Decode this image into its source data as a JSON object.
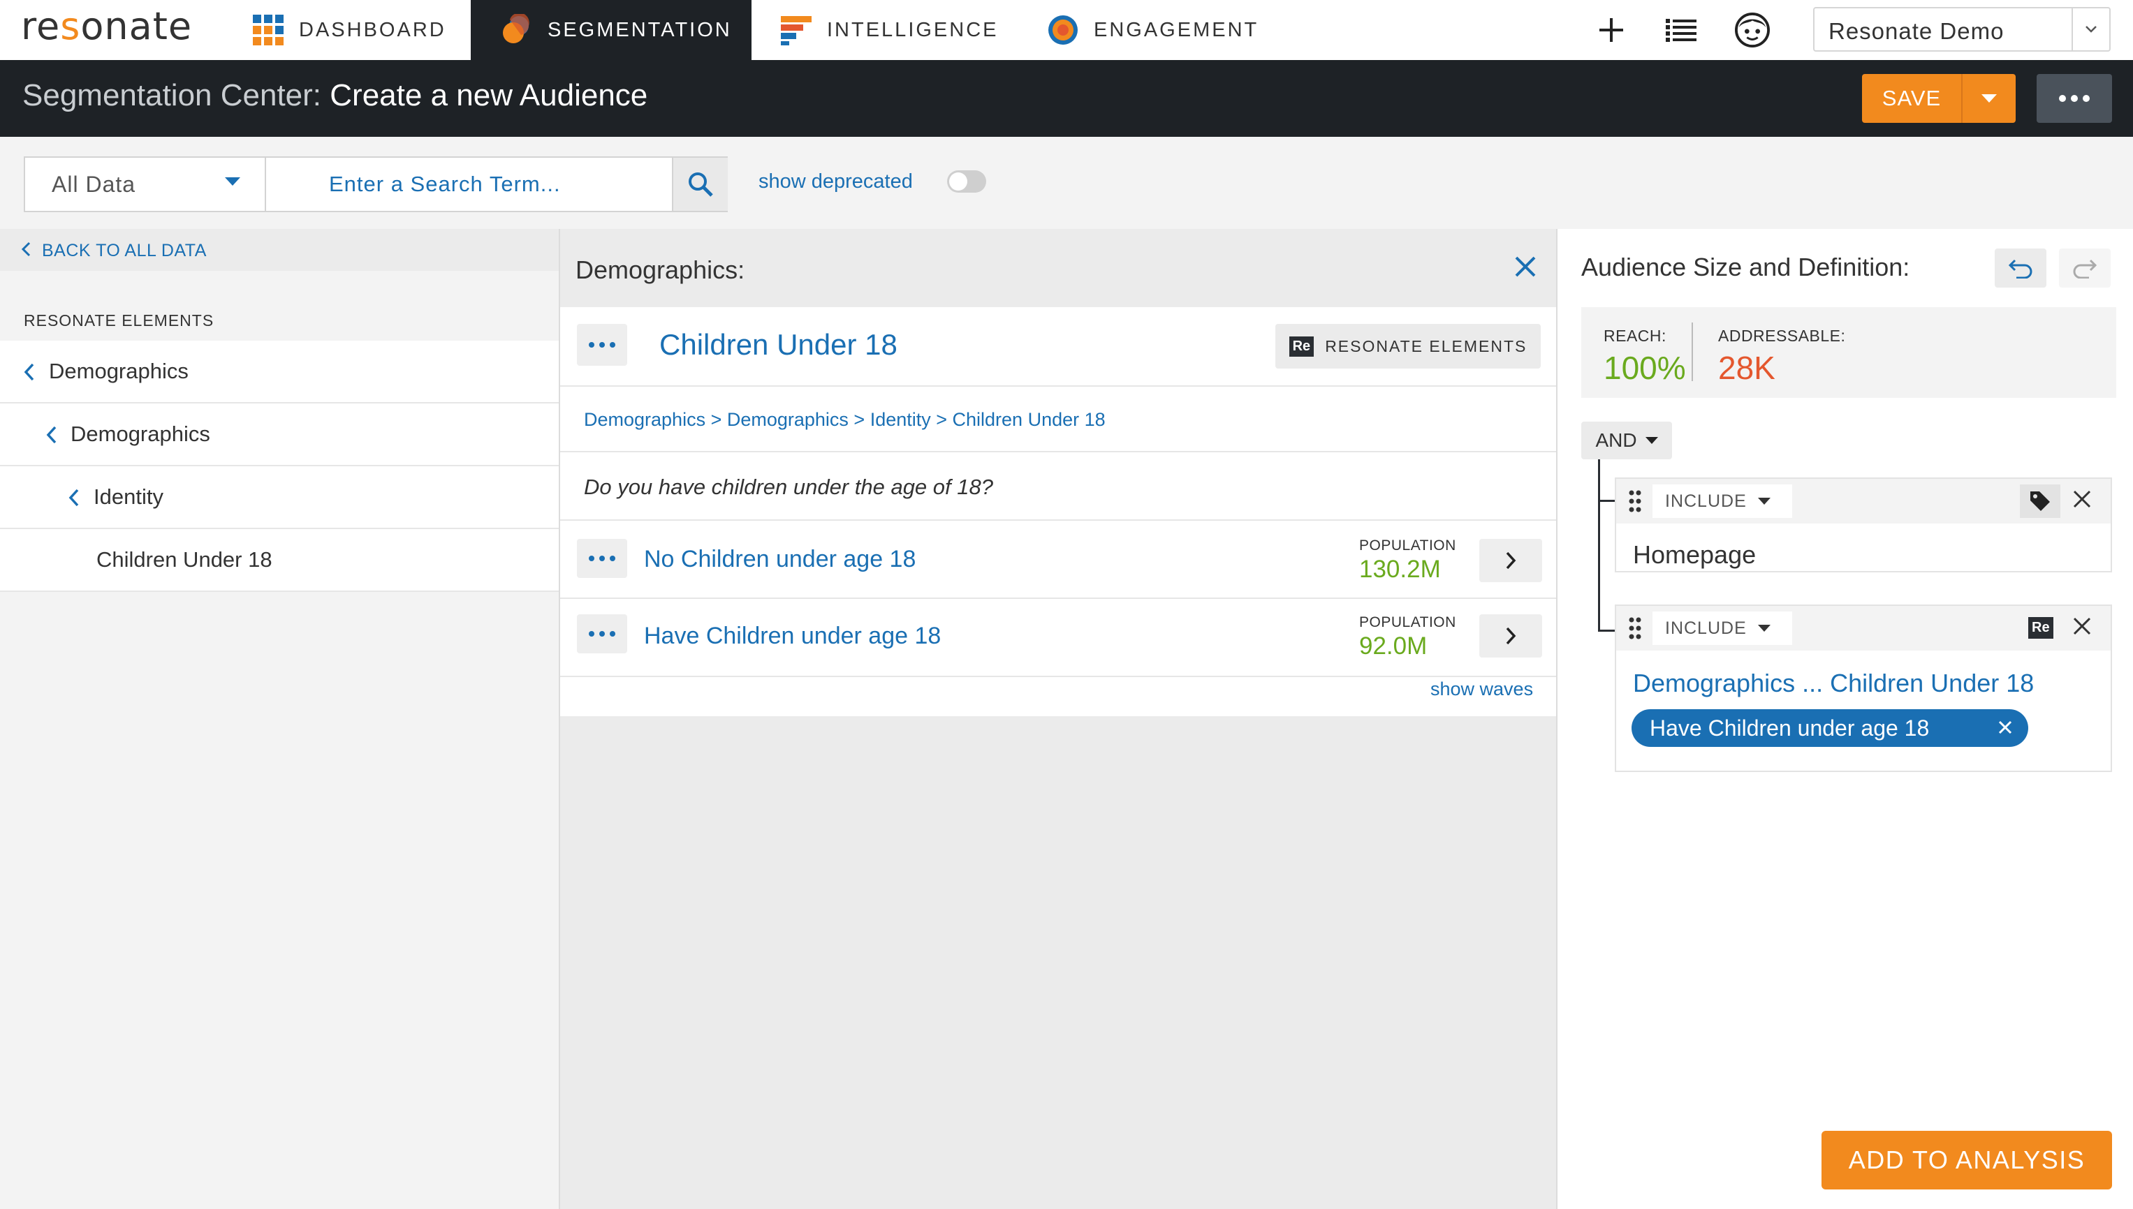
{
  "brand": {
    "logo_pre": "re",
    "logo_o": "s",
    "logo_post": "onate"
  },
  "nav": {
    "tabs": [
      {
        "label": "DASHBOARD",
        "icon": "grid-icon"
      },
      {
        "label": "SEGMENTATION",
        "icon": "segmentation-icon"
      },
      {
        "label": "INTELLIGENCE",
        "icon": "bars-icon"
      },
      {
        "label": "ENGAGEMENT",
        "icon": "target-icon"
      }
    ],
    "account": "Resonate Demo"
  },
  "titlebar": {
    "prefix": "Segmentation Center:",
    "title": "Create a new Audience",
    "save_label": "SAVE"
  },
  "search": {
    "scope": "All Data",
    "placeholder": "Enter a Search Term...",
    "deprecated_label": "show deprecated"
  },
  "left": {
    "back_label": "BACK TO ALL DATA",
    "section_label": "RESONATE ELEMENTS",
    "tree": [
      {
        "label": "Demographics"
      },
      {
        "label": "Demographics"
      },
      {
        "label": "Identity"
      },
      {
        "label": "Children Under 18"
      }
    ]
  },
  "middle": {
    "header": "Demographics:",
    "attribute_title": "Children Under 18",
    "badge_label": "RESONATE ELEMENTS",
    "badge_short": "Re",
    "breadcrumb": "Demographics > Demographics > Identity > Children Under 18",
    "question": "Do you have children under the age of 18?",
    "population_label": "POPULATION",
    "options": [
      {
        "label": "No Children under age 18",
        "population": "130.2M"
      },
      {
        "label": "Have Children under age 18",
        "population": "92.0M"
      }
    ],
    "show_waves": "show waves"
  },
  "right": {
    "title": "Audience Size and Definition:",
    "reach_label": "REACH:",
    "reach_value": "100%",
    "addressable_label": "ADDRESSABLE:",
    "addressable_value": "28K",
    "operator": "AND",
    "rules": [
      {
        "mode": "INCLUDE",
        "value": "Homepage"
      },
      {
        "mode": "INCLUDE",
        "value": "Demographics ... Children Under 18",
        "chip": "Have Children under age 18",
        "badge": "Re"
      }
    ],
    "add_label": "ADD TO ANALYSIS"
  },
  "colors": {
    "accent": "#f28a1e",
    "link": "#1a6fb3",
    "dark": "#1e2226",
    "green": "#6aaa1e",
    "red": "#e4572e"
  }
}
